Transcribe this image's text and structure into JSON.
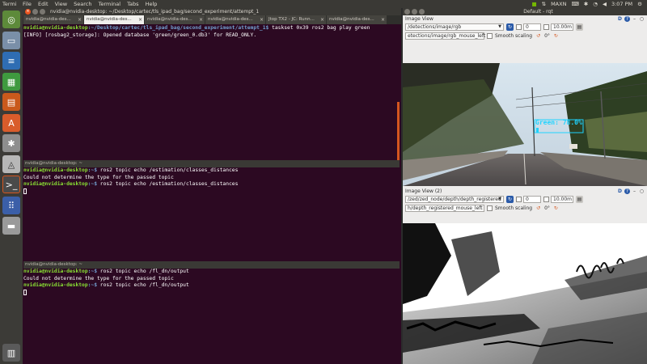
{
  "topbar": {
    "app_name": "Termi",
    "menu": [
      "File",
      "Edit",
      "View",
      "Search",
      "Terminal",
      "Tabs",
      "Help"
    ],
    "tray": [
      "MAXN",
      "3:07 PM"
    ]
  },
  "launcher": {
    "items": [
      "ubuntu-icon",
      "files-icon",
      "writer-icon",
      "calc-icon",
      "impress-icon",
      "software-center-icon",
      "settings-icon",
      "arduino-icon",
      "terminal-icon",
      "apps-grid-icon",
      "drive-icon",
      "trash-icon"
    ]
  },
  "terminal": {
    "title": "nvidia@nvidia-desktop: ~/Desktop/cartec/tls_ipad_bag/second_experiment/attempt_1",
    "tabs": [
      {
        "label": "nvidia@nvidia-des..."
      },
      {
        "label": "nvidia@nvidia-des..."
      },
      {
        "label": "nvidia@nvidia-des..."
      },
      {
        "label": "nvidia@nvidia-des..."
      },
      {
        "label": "Jtop TX2 - JC: Runn..."
      },
      {
        "label": "nvidia@nvidia-des..."
      }
    ],
    "pane1": {
      "prompt": "nvidia@nvidia-desktop",
      "path": ":~/Desktop/cartec/tls_ipad_bag/second_experiment/attempt_1$",
      "command": " taskset 0x39 ros2 bag play green",
      "output": "[INFO] [rosbag2_storage]: Opened database 'green/green_0.db3' for READ_ONLY."
    },
    "pane2": {
      "header": "nvidia@nvidia-desktop: ~",
      "prompt": "nvidia@nvidia-desktop",
      "path": ":~$",
      "command1": " ros2 topic echo /estimation/classes_distances",
      "output": "Could not determine the type for the passed topic",
      "command2": " ros2 topic echo /estimation/classes_distances"
    },
    "pane3": {
      "header": "nvidia@nvidia-desktop: ~",
      "prompt": "nvidia@nvidia-desktop",
      "path": ":~$",
      "command1": " ros2 topic echo /fl_dn/output",
      "output": "Could not determine the type for the passed topic",
      "command2": " ros2 topic echo /fl_dn/output"
    }
  },
  "rqt": {
    "window_title": "Default - rqt",
    "view1": {
      "title": "Image View",
      "topic": "/detections/image/rgb",
      "spin_value": "0",
      "distance": "10.00m",
      "mouse_topic": "etections/image/rgb_mouse_left",
      "smooth_label": "Smooth scaling",
      "rotation": "0°",
      "detection_label": "Green: 78.0%"
    },
    "view2": {
      "title": "Image View (2)",
      "topic": "/zed/zed_node/depth/depth_registered",
      "spin_value": "0",
      "distance": "10.00m",
      "mouse_topic": "h/depth_registered_mouse_left",
      "smooth_label": "Smooth scaling",
      "rotation": "0°"
    }
  },
  "colors": {
    "terminal_bg": "#2c0922",
    "prompt_user": "#8ae234",
    "prompt_path": "#729fcf",
    "scroll_accent": "#d4561f",
    "detection_box": "#1fd3ff"
  }
}
